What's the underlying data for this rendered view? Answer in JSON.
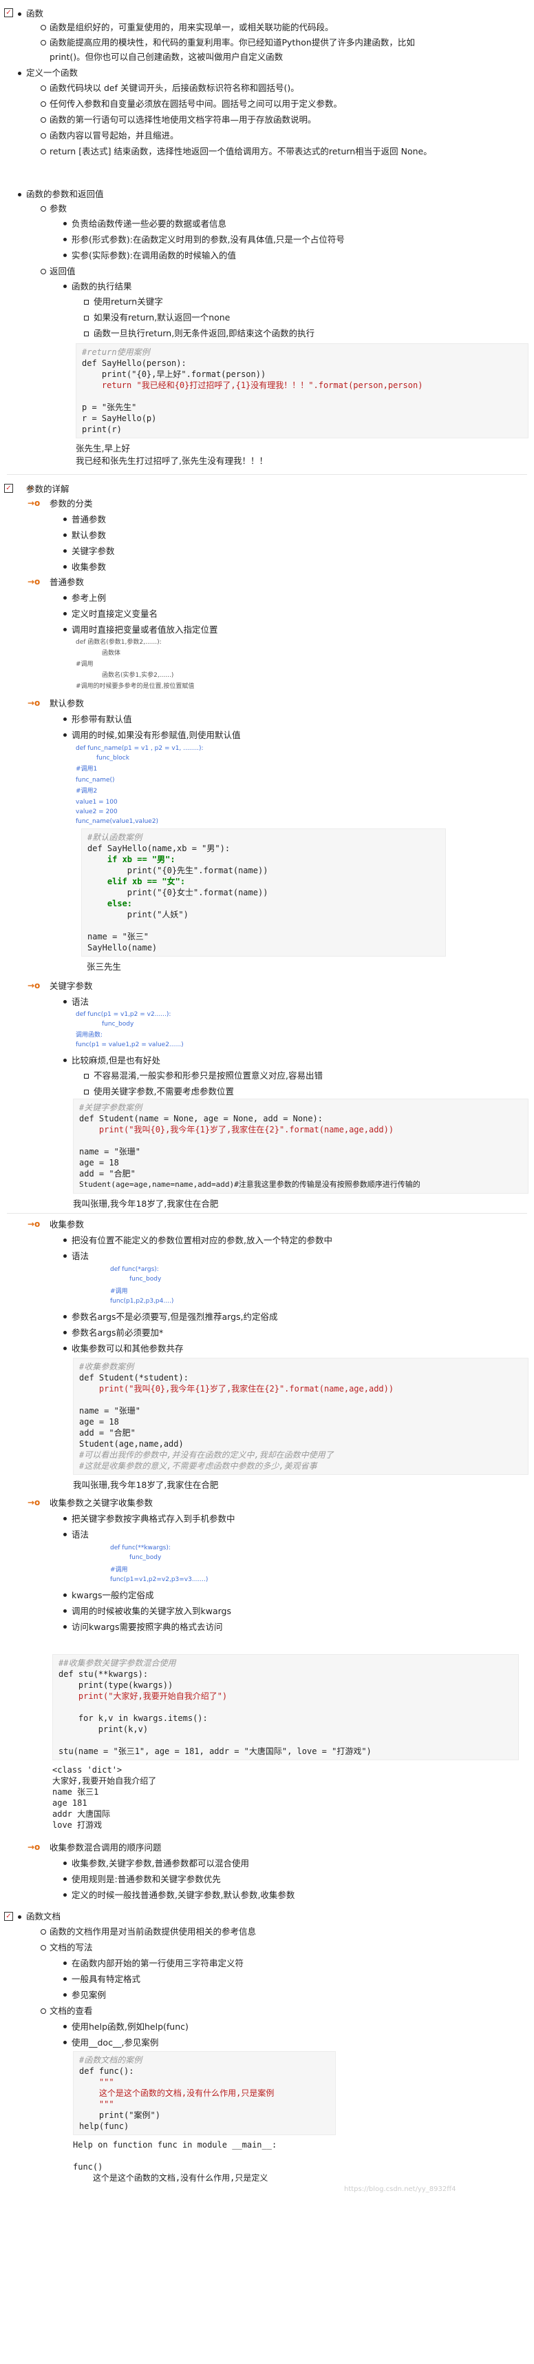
{
  "sec1": {
    "title": "函数",
    "items": [
      "函数是组织好的，可重复使用的，用来实现单一，或相关联功能的代码段。",
      "函数能提高应用的模块性，和代码的重复利用率。你已经知道Python提供了许多内建函数，比如",
      "print()。但你也可以自己创建函数，这被叫做用户自定义函数"
    ],
    "def_title": "定义一个函数",
    "def_items": [
      "函数代码块以 def 关键词开头，后接函数标识符名称和圆括号()。",
      "任何传入参数和自变量必须放在圆括号中间。圆括号之间可以用于定义参数。",
      "函数的第一行语句可以选择性地使用文档字符串—用于存放函数说明。",
      "函数内容以冒号起始，并且缩进。",
      "return [表达式] 结束函数，选择性地返回一个值给调用方。不带表达式的return相当于返回 None。"
    ]
  },
  "sec2": {
    "title": "函数的参数和返回值",
    "param": "参数",
    "param_items": [
      "负责给函数传递一些必要的数据或者信息",
      "形参(形式参数):在函数定义时用到的参数,没有具体值,只是一个占位符号",
      "实参(实际参数):在调用函数的时候输入的值"
    ],
    "ret": "返回值",
    "ret_sub": "函数的执行结果",
    "ret_items": [
      "使用return关键字",
      "如果没有return,默认返回一个none",
      "函数一旦执行return,则无条件返回,即结束这个函数的执行"
    ],
    "code1": [
      "#return使用案例",
      "def SayHello(person):",
      "    print(\"{0},早上好\".format(person))",
      "    return \"我已经和{0}打过招呼了,{1}没有理我！！！\".format(person,person)",
      "",
      "p = \"张先生\"",
      "r = SayHello(p)",
      "print(r)"
    ],
    "out1": [
      "张先生,早上好",
      "我已经和张先生打过招呼了,张先生没有理我！！！"
    ]
  },
  "sec3": {
    "title": "参数的详解",
    "cls": "参数的分类",
    "cls_items": [
      "普通参数",
      "默认参数",
      "关键字参数",
      "收集参数"
    ],
    "normal": "普通参数",
    "normal_items": [
      "参考上例",
      "定义时直接定义变量名",
      "调用时直接把变量或者值放入指定位置"
    ],
    "normal_code": [
      "def 函数名(参数1,参数2,......):",
      "函数体",
      "#调用",
      "函数名(实参1,实参2,......)",
      "#调用的时候要多参考的是位置,按位置赋值"
    ],
    "default": "默认参数",
    "default_items": [
      "形参带有默认值",
      "调用的时候,如果没有形参赋值,则使用默认值"
    ],
    "default_code": [
      "def func_name(p1 = v1 , p2 = v1, ........):",
      "func_block",
      "#调用1",
      "func_name()",
      "#调用2",
      "value1 = 100",
      "value2 = 200",
      "func_name(value1,value2)"
    ],
    "code2": [
      "#默认函数案例",
      "def SayHello(name,xb = \"男\"):",
      "    if xb == \"男\":",
      "        print(\"{0}先生\".format(name))",
      "    elif xb == \"女\":",
      "        print(\"{0}女士\".format(name))",
      "    else:",
      "        print(\"人妖\")",
      "",
      "name = \"张三\"",
      "SayHello(name)"
    ],
    "out2": "张三先生",
    "kw": "关键字参数",
    "kw_syntax": "语法",
    "kw_code": [
      "def func(p1 = v1,p2 = v2......):",
      "func_body",
      "调用函数:",
      "func(p1 = value1,p2 = value2......)"
    ],
    "kw_items": [
      "比较麻烦,但是也有好处",
      "不容易混淆,一般实参和形参只是按照位置意义对应,容易出错",
      "使用关键字参数,不需要考虑参数位置"
    ],
    "code3": [
      "#关键字参数案例",
      "def Student(name = None, age = None, add = None):",
      "    print(\"我叫{0},我今年{1}岁了,我家住在{2}\".format(name,age,add))",
      "",
      "name = \"张珊\"",
      "age = 18",
      "add = \"合肥\"",
      "Student(age=age,name=name,add=add)#注意我这里参数的传输是没有按照参数顺序进行传输的"
    ],
    "out3": "我叫张珊,我今年18岁了,我家住在合肥",
    "collect": "收集参数",
    "collect_items": [
      "把没有位置不能定义的参数位置相对应的参数,放入一个特定的参数中",
      "语法"
    ],
    "collect_code": [
      "def func(*args):",
      "func_body",
      "#调用",
      "func(p1,p2,p3,p4....)"
    ],
    "collect_items2": [
      "参数名args不是必须要写,但是强烈推荐args,约定俗成",
      "参数名args前必须要加*",
      "收集参数可以和其他参数共存"
    ],
    "code4": [
      "#收集参数案例",
      "def Student(*student):",
      "    print(\"我叫{0},我今年{1}岁了,我家住在{2}\".format(name,age,add))",
      "",
      "name = \"张珊\"",
      "age = 18",
      "add = \"合肥\"",
      "Student(age,name,add)",
      "#可以看出我传的参数中,并没有在函数的定义中,我却在函数中使用了",
      "#这就是收集参数的意义,不需要考虑函数中参数的多少,美观省事"
    ],
    "out4": "我叫张珊,我今年18岁了,我家住在合肥",
    "kwc": "收集参数之关键字收集参数",
    "kwc_items": [
      "把关键字参数按字典格式存入到手机参数中",
      "语法"
    ],
    "kwc_code": [
      "def func(**kwargs):",
      "func_body",
      "#调用",
      "func(p1=v1,p2=v2,p3=v3.......)"
    ],
    "kwc_items2": [
      "kwargs一般约定俗成",
      "调用的时候被收集的关键字放入到kwargs",
      "访问kwargs需要按照字典的格式去访问"
    ],
    "code5": [
      "##收集参数关键字参数混合使用",
      "def stu(**kwargs):",
      "    print(type(kwargs))",
      "    print(\"大家好,我要开始自我介绍了\")",
      "",
      "    for k,v in kwargs.items():",
      "        print(k,v)",
      "",
      "stu(name = \"张三1\", age = 181, addr = \"大唐国际\", love = \"打游戏\")"
    ],
    "out5": [
      "<class 'dict'>",
      "大家好,我要开始自我介绍了",
      "name 张三1",
      "age 181",
      "addr 大唐国际",
      "love 打游戏"
    ],
    "order": "收集参数混合调用的顺序问题",
    "order_items": [
      "收集参数,关键字参数,普通参数都可以混合使用",
      "使用规则是:普通参数和关键字参数优先",
      "定义的时候一般找普通参数,关键字参数,默认参数,收集参数"
    ]
  },
  "sec4": {
    "title": "函数文档",
    "items": [
      "函数的文档作用是对当前函数提供使用相关的参考信息",
      "文档的写法"
    ],
    "write_items": [
      "在函数内部开始的第一行使用三字符串定义符",
      "一般具有特定格式",
      "参见案例"
    ],
    "view": "文档的查看",
    "view_items": [
      "使用help函数,例如help(func)",
      "使用__doc__,参见案例"
    ],
    "code6": [
      "#函数文档的案例",
      "def func():",
      "    \"\"\"",
      "    这个是这个函数的文档,没有什么作用,只是案例",
      "    \"\"\"",
      "    print(\"案例\")",
      "help(func)"
    ],
    "out6": [
      "Help on function func in module __main__:",
      "",
      "func()",
      "    这个是这个函数的文档,没有什么作用,只是定义"
    ],
    "watermark": "https://blog.csdn.net/yy_8932ff4"
  }
}
